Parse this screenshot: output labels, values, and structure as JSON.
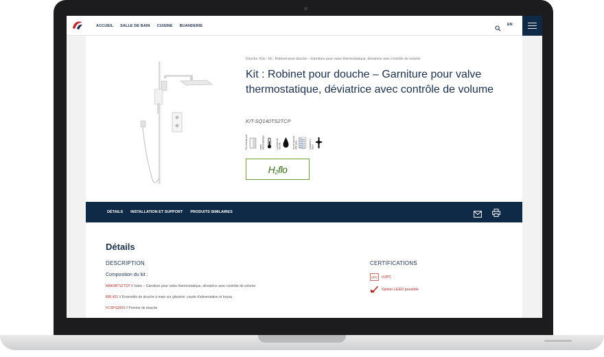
{
  "nav": {
    "links": [
      "ACCUEIL",
      "SALLE DE BAIN",
      "CUISINE",
      "BUANDERIE"
    ],
    "lang": "EN"
  },
  "product": {
    "breadcrumb": "Douche, Kits › Kit : Robinet pour douche – Garniture pour valve thermostatique, déviatrice avec contrôle de volume",
    "title": "Kit : Robinet pour douche – Garniture pour valve thermostatique, déviatrice avec contrôle de volume",
    "sku": "KIT-SQ140TS2TCP",
    "features": [
      {
        "label": "Fini chrome poli",
        "icon": "chrome-finish-icon"
      },
      {
        "label": "Valve thermostatique",
        "icon": "thermostat-icon"
      },
      {
        "label": "Contrôle de volume",
        "icon": "volume-control-icon"
      },
      {
        "label": "Jet de douche effet pluie",
        "icon": "rain-spray-icon"
      },
      {
        "label": "Déviateur 2 voies",
        "icon": "diverter-icon"
      }
    ],
    "badge": "H₂flo"
  },
  "tabs": [
    "DÉTAILS",
    "INSTALLATION ET SUPPORT",
    "PRODUITS SIMILAIRES"
  ],
  "details": {
    "title": "Détails",
    "description_title": "DESCRIPTION",
    "composition_title": "Composition du kit :",
    "components": [
      {
        "code": "MAK98TS2TCP",
        "text": " // Valve – Garniture pour valve thermostatique, déviatrice avec contrôle de volume"
      },
      {
        "code": "890-431",
        "text": " // Ensemble de douche à main sur glissière, coude d'alimentation et boyau"
      },
      {
        "code": "FCSPS3003",
        "text": " // Pomme de douche"
      }
    ],
    "certifications_title": "CERTIFICATIONS",
    "certifications": [
      {
        "label": "cUPC",
        "icon": "cupc-icon"
      },
      {
        "label": "Option LEED possible",
        "icon": "leed-icon"
      }
    ]
  },
  "colors": {
    "navy": "#0f2a47",
    "accent_red": "#b02a2a",
    "green": "#6e9a2e"
  }
}
